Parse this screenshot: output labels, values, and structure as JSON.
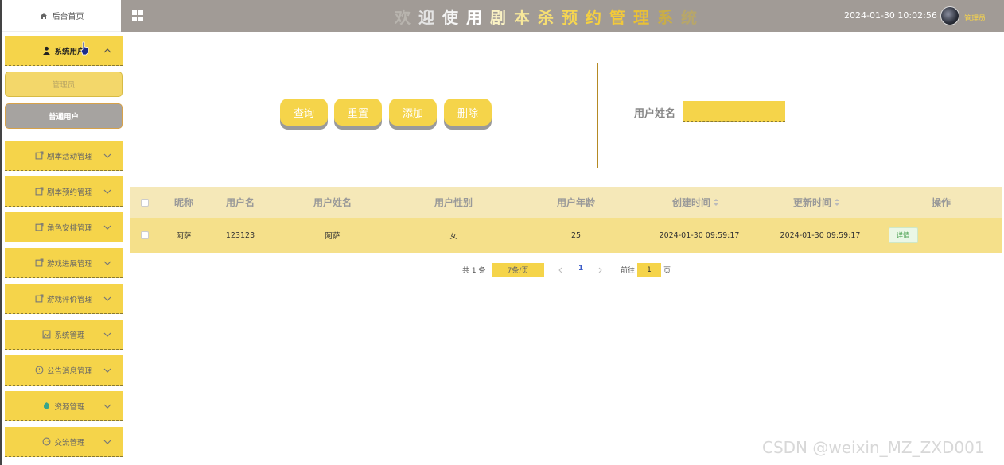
{
  "sidebar": {
    "home": "后台首页",
    "system_users": "系统用户",
    "sub_items": [
      "管理员",
      "普通用户"
    ],
    "groups": [
      {
        "label": "剧本活动管理",
        "icon": "note-icon"
      },
      {
        "label": "剧本预约管理",
        "icon": "note-icon"
      },
      {
        "label": "角色安排管理",
        "icon": "note-icon"
      },
      {
        "label": "游戏进展管理",
        "icon": "note-icon"
      },
      {
        "label": "游戏评价管理",
        "icon": "note-icon"
      },
      {
        "label": "系统管理",
        "icon": "image-icon"
      },
      {
        "label": "公告消息管理",
        "icon": "info-icon"
      },
      {
        "label": "资源管理",
        "icon": "resource-icon"
      },
      {
        "label": "交流管理",
        "icon": "chat-icon"
      }
    ]
  },
  "header": {
    "title_chars": [
      "欢",
      "迎",
      "使",
      "用",
      "剧",
      "本",
      "杀",
      "预",
      "约",
      "管",
      "理",
      "系",
      "统"
    ],
    "title_colors": [
      "#b8b4ae",
      "#e4e4e4",
      "#f4f4f4",
      "#ffffff",
      "#fbf3c4",
      "#f8e89a",
      "#f6de72",
      "#f6d650",
      "#f5d040",
      "#f2c93a",
      "#e9c035",
      "#c9ad48",
      "#b7a66a"
    ],
    "datetime": "2024-01-30 10:02:56",
    "admin": "管理员"
  },
  "toolbar": {
    "query": "查询",
    "reset": "重置",
    "add": "添加",
    "delete": "删除"
  },
  "search": {
    "label": "用户姓名",
    "value": ""
  },
  "table": {
    "headers": [
      "昵称",
      "用户名",
      "用户姓名",
      "用户性别",
      "用户年龄",
      "创建时间",
      "更新时间",
      "操作"
    ],
    "rows": [
      {
        "nickname": "阿萨",
        "username": "123123",
        "realname": "阿萨",
        "gender": "女",
        "age": "25",
        "created": "2024-01-30 09:59:17",
        "updated": "2024-01-30 09:59:17",
        "action": "详情"
      }
    ]
  },
  "pagination": {
    "total": "共 1 条",
    "page_size": "7条/页",
    "current": "1",
    "goto_prefix": "前往",
    "goto_value": "1",
    "goto_suffix": "页"
  },
  "watermark": "CSDN @weixin_MZ_ZXD001",
  "colors": {
    "accent": "#f5d44a",
    "header": "#a19b96",
    "gold_line": "#b58a24"
  }
}
